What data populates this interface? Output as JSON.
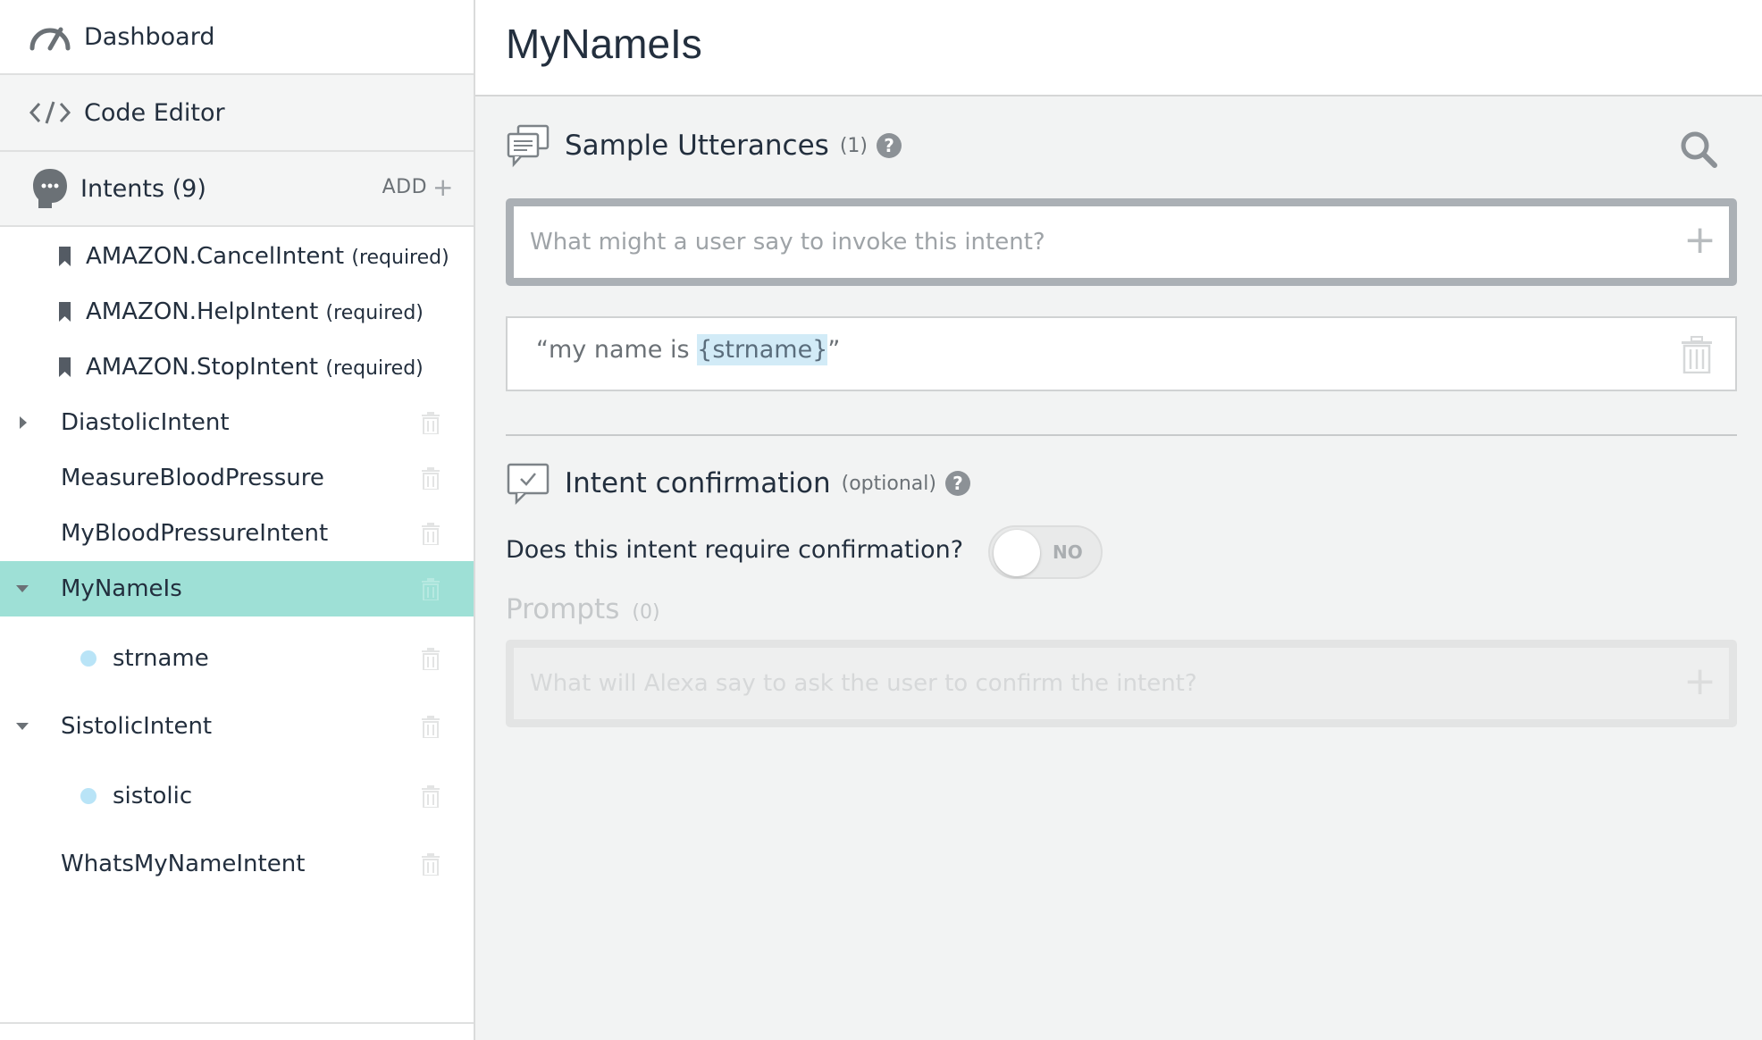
{
  "sidebar": {
    "dashboard_label": "Dashboard",
    "code_editor_label": "Code Editor",
    "intents_label": "Intents (9)",
    "add_label": "ADD",
    "add_icon": "+",
    "intents": [
      {
        "name": "AMAZON.CancelIntent",
        "tag": "(required)",
        "kind": "builtin"
      },
      {
        "name": "AMAZON.HelpIntent",
        "tag": "(required)",
        "kind": "builtin"
      },
      {
        "name": "AMAZON.StopIntent",
        "tag": "(required)",
        "kind": "builtin"
      },
      {
        "name": "DiastolicIntent",
        "kind": "custom",
        "expanded": false
      },
      {
        "name": "MeasureBloodPressure",
        "kind": "custom"
      },
      {
        "name": "MyBloodPressureIntent",
        "kind": "custom"
      },
      {
        "name": "MyNameIs",
        "kind": "custom",
        "expanded": true,
        "selected": true
      },
      {
        "name": "strname",
        "kind": "slot"
      },
      {
        "name": "SistolicIntent",
        "kind": "custom",
        "expanded": true
      },
      {
        "name": "sistolic",
        "kind": "slot"
      },
      {
        "name": "WhatsMyNameIntent",
        "kind": "custom"
      }
    ]
  },
  "main": {
    "title": "MyNameIs",
    "sample_utterances": {
      "title": "Sample Utterances",
      "count": "(1)",
      "help": "?",
      "input_placeholder": "What might a user say to invoke this intent?",
      "add_icon": "+",
      "utterances": [
        {
          "before": "“my name is ",
          "slot": "{strname}",
          "after": "”"
        }
      ]
    },
    "intent_confirmation": {
      "title": "Intent confirmation",
      "tag": "(optional)",
      "help": "?",
      "question": "Does this intent require confirmation?",
      "toggle_label": "NO",
      "prompts_title": "Prompts",
      "prompts_count": "(0)",
      "prompt_placeholder": "What will Alexa say to ask the user to confirm the intent?",
      "add_icon": "+"
    }
  },
  "colors": {
    "selected_row": "#9ee0d6",
    "slot_dot": "#b9e4f7",
    "slot_highlight": "#d2ebf7",
    "text": "#232f3e",
    "muted": "#6b7176"
  }
}
